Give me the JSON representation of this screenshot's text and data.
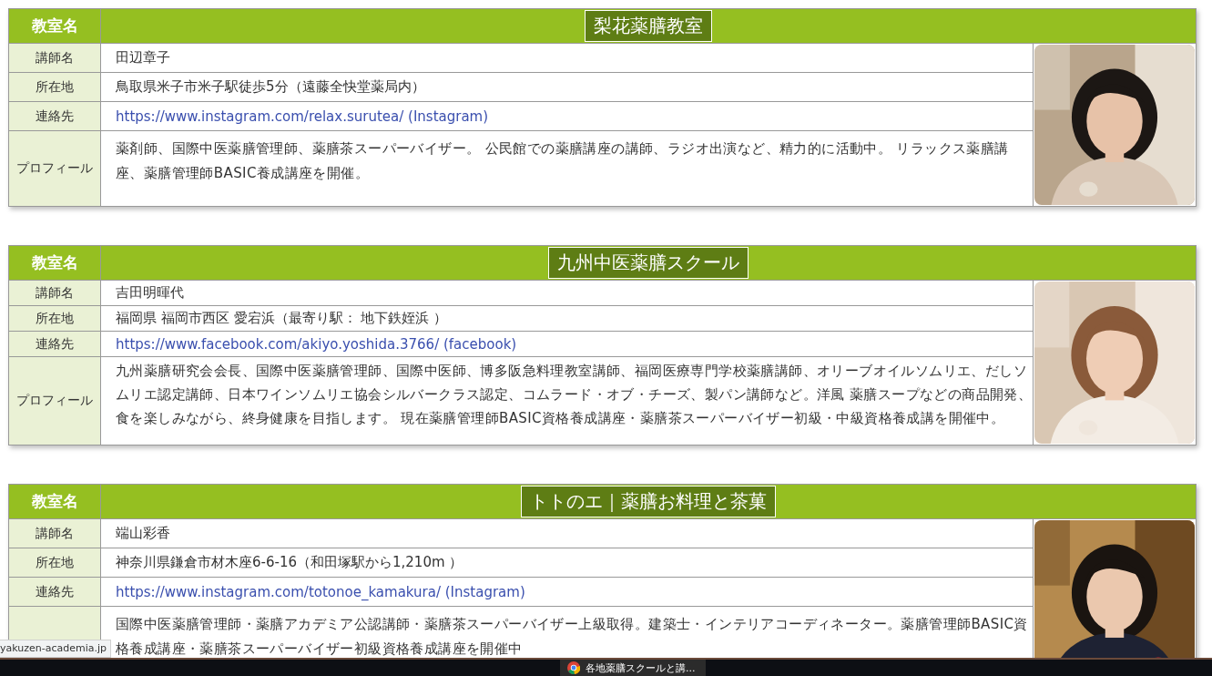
{
  "schools": [
    {
      "header_label": "教室名",
      "name": "梨花薬膳教室",
      "rows": [
        {
          "label": "講師名",
          "kind": "text",
          "value": "田辺章子"
        },
        {
          "label": "所在地",
          "kind": "text",
          "value": "鳥取県米子市米子駅徒歩5分（遠藤全快堂薬局内）"
        },
        {
          "label": "連絡先",
          "kind": "link",
          "value": "https://www.instagram.com/relax.surutea/ (Instagram)"
        },
        {
          "label": "プロフィール",
          "kind": "text",
          "value": "薬剤師、国際中医薬膳管理師、薬膳茶スーパーバイザー。 公民館での薬膳講座の講師、ラジオ出演など、精力的に活動中。 リラックス薬膳講座、薬膳管理師BASIC養成講座を開催。"
        }
      ]
    },
    {
      "header_label": "教室名",
      "name": "九州中医薬膳スクール",
      "rows": [
        {
          "label": "講師名",
          "kind": "text",
          "value": "吉田明暉代"
        },
        {
          "label": "所在地",
          "kind": "text",
          "value": "福岡県 福岡市西区 愛宕浜（最寄り駅： 地下鉄姪浜 ）"
        },
        {
          "label": "連絡先",
          "kind": "link",
          "value": "https://www.facebook.com/akiyo.yoshida.3766/ (facebook)"
        },
        {
          "label": "プロフィール",
          "kind": "text",
          "value": "九州薬膳研究会会長、国際中医薬膳管理師、国際中医師、博多阪急料理教室講師、福岡医療専門学校薬膳講師、オリーブオイルソムリエ、だしソムリエ認定講師、日本ワインソムリエ協会シルバークラス認定、コムラード・オブ・チーズ、製パン講師など。洋風 薬膳スープなどの商品開発、食を楽しみながら、終身健康を目指します。 現在薬膳管理師BASIC資格養成講座・薬膳茶スーパーバイザー初級・中級資格養成講を開催中。"
        }
      ]
    },
    {
      "header_label": "教室名",
      "name": "トトのエ｜薬膳お料理と茶菓",
      "rows": [
        {
          "label": "講師名",
          "kind": "text",
          "value": "端山彩香"
        },
        {
          "label": "所在地",
          "kind": "text",
          "value": "神奈川県鎌倉市材木座6-6-16（和田塚駅から1,210m ）"
        },
        {
          "label": "連絡先",
          "kind": "link",
          "value": "https://www.instagram.com/totonoe_kamakura/ (Instagram)"
        },
        {
          "kind": "text",
          "value": "国際中医薬膳管理師・薬膳アカデミア公認講師・薬膳茶スーパーバイザー上級取得。建築士・インテリアコーディネーター。薬膳管理師BASIC資格養成講座・薬膳茶スーパーバイザー初級資格養成講座を開催中"
        }
      ]
    }
  ],
  "status_url": "yakuzen-academia.jp",
  "taskbar": {
    "tabs": [
      {
        "label": "各地薬膳スクールと講...",
        "selected": true
      }
    ]
  }
}
